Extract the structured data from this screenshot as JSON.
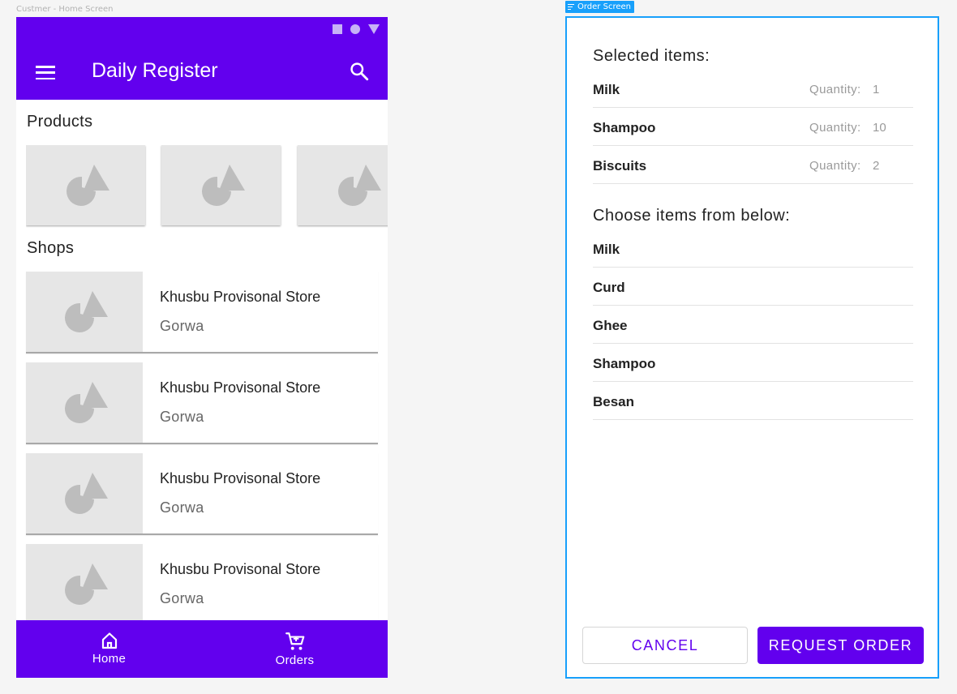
{
  "frames": {
    "home_label": "Custmer - Home Screen",
    "order_label": "Order Screen"
  },
  "colors": {
    "primary": "#6200ee",
    "frame_selection": "#18a0fb",
    "placeholder_bg": "#e6e6e6",
    "placeholder_shape": "#bdbdbd"
  },
  "home": {
    "app_title": "Daily Register",
    "icons": {
      "menu": "menu-icon",
      "search": "search-icon"
    },
    "products_title": "Products",
    "products": [
      {
        "image": "image-placeholder-icon"
      },
      {
        "image": "image-placeholder-icon"
      },
      {
        "image": "image-placeholder-icon"
      }
    ],
    "shops_title": "Shops",
    "shops": [
      {
        "name": "Khusbu Provisonal Store",
        "location": "Gorwa"
      },
      {
        "name": "Khusbu Provisonal Store",
        "location": "Gorwa"
      },
      {
        "name": "Khusbu Provisonal Store",
        "location": "Gorwa"
      },
      {
        "name": "Khusbu Provisonal Store",
        "location": "Gorwa"
      }
    ],
    "bottom_nav": [
      {
        "label": "Home",
        "icon": "home-icon"
      },
      {
        "label": "Orders",
        "icon": "cart-icon"
      }
    ]
  },
  "order": {
    "selected_title": "Selected items:",
    "selected_items": [
      {
        "name": "Milk",
        "qty_label": "Quantity:",
        "qty": "1"
      },
      {
        "name": "Shampoo",
        "qty_label": "Quantity:",
        "qty": "10"
      },
      {
        "name": "Biscuits",
        "qty_label": "Quantity:",
        "qty": "2"
      }
    ],
    "choose_title": "Choose items from below:",
    "choose_items": [
      "Milk",
      "Curd",
      "Ghee",
      "Shampoo",
      "Besan"
    ],
    "cancel_label": "CANCEL",
    "request_label": "REQUEST ORDER"
  }
}
